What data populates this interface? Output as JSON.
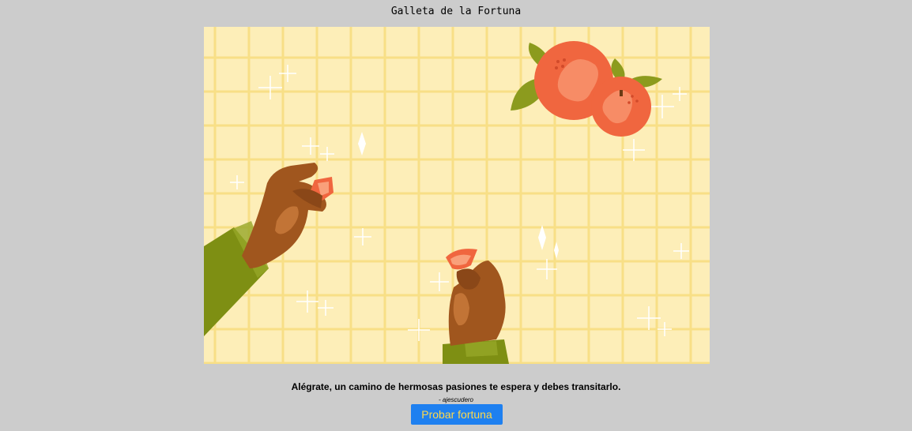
{
  "app": {
    "title": "Galleta de la Fortuna"
  },
  "illustration": {
    "description_icon": "fortune-cookie-hands-illustration",
    "colors": {
      "background": "#fdeeb8",
      "grid": "#f8df86",
      "orange": "#f0663f",
      "skin": "#a0561e",
      "sleeve": "#7e8f13"
    }
  },
  "fortune": {
    "message": "Alégrate, un camino de hermosas pasiones te espera y debes transitarlo.",
    "author": "- ajescudero"
  },
  "actions": {
    "try_label": "Probar fortuna"
  },
  "colors": {
    "page_bg": "#cccccc",
    "button_bg": "#1e80f0",
    "button_text": "#ffd84a"
  }
}
